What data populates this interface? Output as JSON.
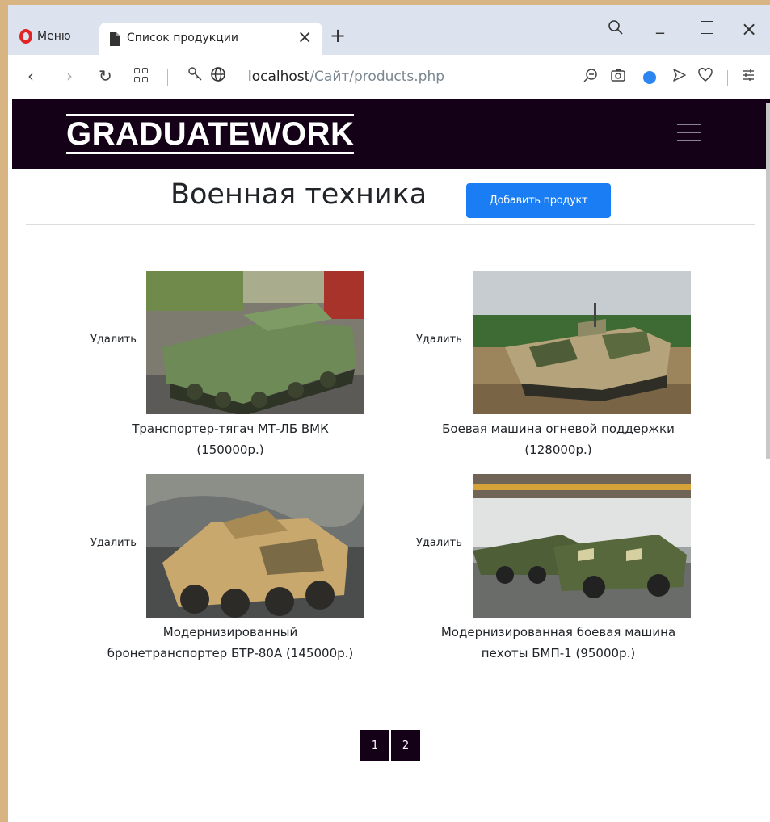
{
  "browser": {
    "menu_label": "Меню",
    "tab_title": "Список продукции",
    "url_host": "localhost",
    "url_path": "/Сайт/products.php"
  },
  "site": {
    "brand": "GRADUATEWORK",
    "page_title": "Военная техника",
    "add_button": "Добавить продукт",
    "delete_label": "Удалить",
    "products": [
      {
        "line1": "Транспортер-тягач МТ-ЛБ ВМК",
        "line2": "(150000р.)"
      },
      {
        "line1": "Боевая машина огневой поддержки",
        "line2": "(128000р.)"
      },
      {
        "line1": "Модернизированный",
        "line2": "бронетранспортер БТР-80А (145000р.)"
      },
      {
        "line1": "Модернизированная боевая машина",
        "line2": "пехоты БМП-1 (95000р.)"
      }
    ],
    "pages": [
      "1",
      "2"
    ]
  },
  "colors": {
    "navbar": "#140017",
    "accent_button": "#1a7df3",
    "tabstrip": "#dde3ee"
  }
}
